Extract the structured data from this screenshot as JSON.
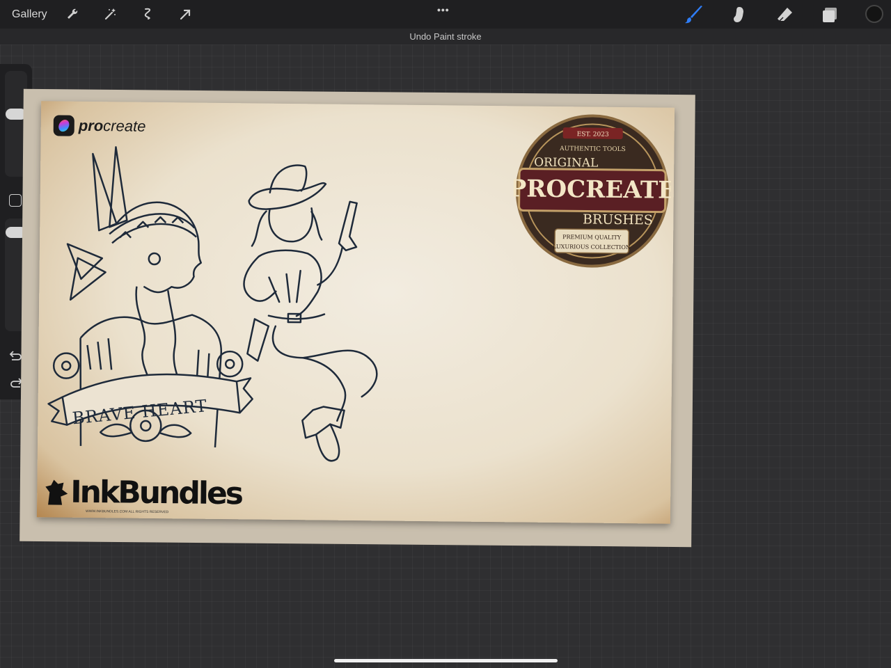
{
  "toolbar": {
    "gallery_label": "Gallery",
    "left_tools": [
      "wrench-icon",
      "magic-wand-icon",
      "selection-icon",
      "transform-icon"
    ],
    "more_dots": "•••",
    "right_tools": [
      "brush-icon",
      "smudge-icon",
      "eraser-icon",
      "layers-icon"
    ],
    "active_tool": "brush",
    "accent_color": "#2f7df6",
    "current_color": "#141414"
  },
  "notification": {
    "text": "Undo Paint stroke"
  },
  "sidebar": {
    "brush_size_slider": "size",
    "modifier_button": "square",
    "opacity_slider": "opacity",
    "undo": "undo-icon",
    "redo": "redo-icon"
  },
  "artwork": {
    "logo_brand": "procreate",
    "logo_brand_bold": "pro",
    "logo_brand_rest": "create",
    "banner_text": "BRAVE HEART",
    "inkbundles_text": "InkBundles",
    "inkbundles_small": "WWW.INKBUNDLES.COM  ALL RIGHTS RESERVED",
    "badge": {
      "est": "EST. 2023",
      "authentic": "AUTHENTIC TOOLS",
      "original": "ORIGINAL",
      "procreate": "PROCREATE",
      "brushes": "BRUSHES",
      "premium": "PREMIUM QUALITY",
      "luxurious": "LUXURIOUS COLLECTION"
    }
  }
}
